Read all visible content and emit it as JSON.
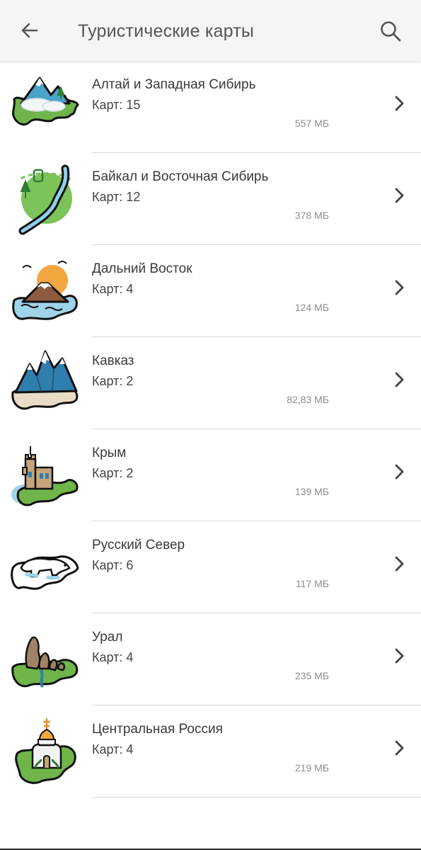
{
  "header": {
    "title": "Туристические карты",
    "back_icon": "arrow-back-icon",
    "search_icon": "search-icon"
  },
  "items": [
    {
      "title": "Алтай и Западная Сибирь",
      "count": "Карт: 15",
      "size": "557 МБ",
      "icon": "altai-mountains-icon"
    },
    {
      "title": "Байкал и Восточная Сибирь",
      "count": "Карт: 12",
      "size": "378 МБ",
      "icon": "baikal-lake-icon"
    },
    {
      "title": "Дальний Восток",
      "count": "Карт: 4",
      "size": "124 МБ",
      "icon": "far-east-volcano-icon"
    },
    {
      "title": "Кавказ",
      "count": "Карт: 2",
      "size": "82,83 МБ",
      "icon": "caucasus-mountains-icon"
    },
    {
      "title": "Крым",
      "count": "Карт: 2",
      "size": "139 МБ",
      "icon": "crimea-castle-icon"
    },
    {
      "title": "Русский Север",
      "count": "Карт: 6",
      "size": "117 МБ",
      "icon": "polar-bear-icon"
    },
    {
      "title": "Урал",
      "count": "Карт: 4",
      "size": "235 МБ",
      "icon": "ural-rocks-icon"
    },
    {
      "title": "Центральная Россия",
      "count": "Карт: 4",
      "size": "219 МБ",
      "icon": "church-icon"
    }
  ],
  "colors": {
    "appbar_bg": "#f5f5f5",
    "title_text": "#555555",
    "secondary_text": "#8c8c8c",
    "divider": "#d9d9d9",
    "map_green": "#6fb54a",
    "water_blue": "#9fd3ea"
  }
}
